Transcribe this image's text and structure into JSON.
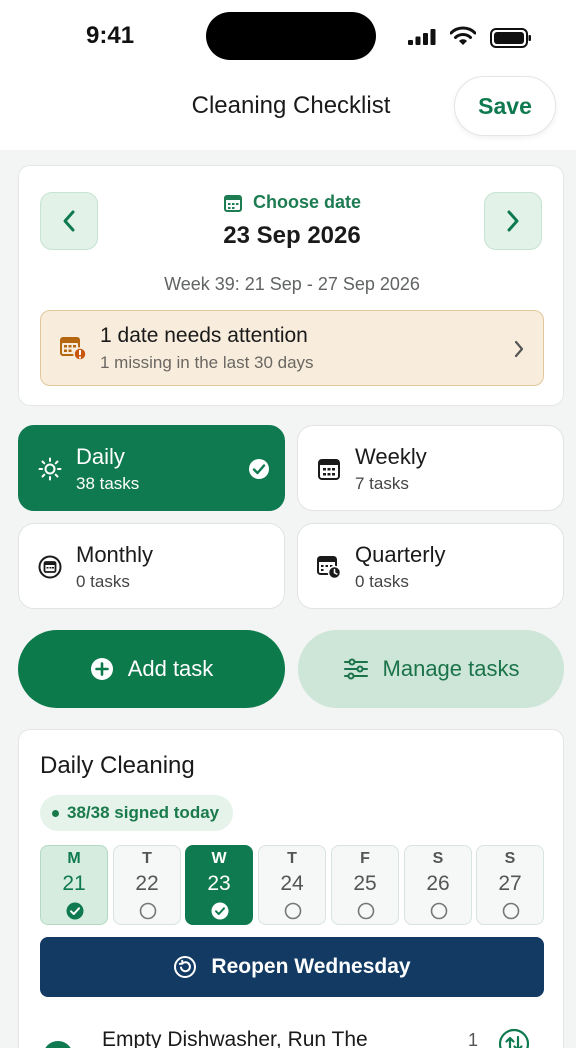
{
  "status_bar": {
    "time": "9:41"
  },
  "nav": {
    "title": "Cleaning Checklist",
    "save_label": "Save"
  },
  "date_picker": {
    "choose_label": "Choose date",
    "date": "23 Sep 2026",
    "week_range": "Week 39: 21 Sep - 27 Sep 2026",
    "attention": {
      "title": "1 date needs attention",
      "subtitle": "1 missing in the last 30 days"
    }
  },
  "frequencies": [
    {
      "label": "Daily",
      "count": "38 tasks",
      "selected": true,
      "icon": "sun-icon"
    },
    {
      "label": "Weekly",
      "count": "7 tasks",
      "selected": false,
      "icon": "calendar-icon"
    },
    {
      "label": "Monthly",
      "count": "0 tasks",
      "selected": false,
      "icon": "month-icon"
    },
    {
      "label": "Quarterly",
      "count": "0 tasks",
      "selected": false,
      "icon": "calendar-clock-icon"
    }
  ],
  "actions": {
    "add_task": "Add task",
    "manage_tasks": "Manage tasks"
  },
  "daily_section": {
    "title": "Daily Cleaning",
    "signed_status": "38/38 signed today",
    "days": [
      {
        "letter": "M",
        "num": "21",
        "state": "done"
      },
      {
        "letter": "T",
        "num": "22",
        "state": "pending"
      },
      {
        "letter": "W",
        "num": "23",
        "state": "selected"
      },
      {
        "letter": "T",
        "num": "24",
        "state": "pending"
      },
      {
        "letter": "F",
        "num": "25",
        "state": "pending"
      },
      {
        "letter": "S",
        "num": "26",
        "state": "pending"
      },
      {
        "letter": "S",
        "num": "27",
        "state": "pending"
      }
    ],
    "reopen_label": "Reopen Wednesday",
    "tasks": [
      {
        "name": "Empty Dishwasher, Run The",
        "count": "1"
      }
    ]
  },
  "colors": {
    "primary_green": "#0f7a4f",
    "light_green": "#cde6d8",
    "navy": "#123a63",
    "warning_bg": "#f8eddd",
    "warning_accent": "#c77a12"
  }
}
